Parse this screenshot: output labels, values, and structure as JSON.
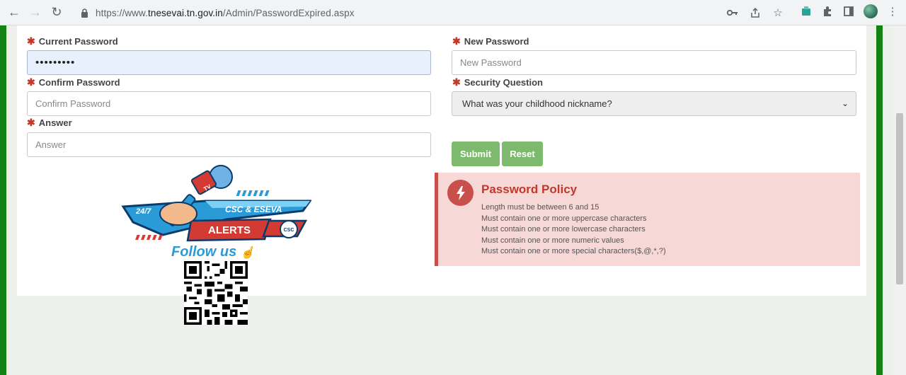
{
  "browser": {
    "url_prefix": "https://www.",
    "url_host": "tnesevai.tn.gov.in",
    "url_path": "/Admin/PasswordExpired.aspx"
  },
  "form": {
    "current_password": {
      "label": "Current Password",
      "value": "•••••••••"
    },
    "new_password": {
      "label": "New Password",
      "placeholder": "New Password"
    },
    "confirm_password": {
      "label": "Confirm Password",
      "placeholder": "Confirm Password"
    },
    "security_question": {
      "label": "Security Question",
      "selected": "What was your childhood nickname?"
    },
    "answer": {
      "label": "Answer",
      "placeholder": "Answer"
    },
    "submit_label": "Submit",
    "reset_label": "Reset"
  },
  "policy": {
    "title": "Password Policy",
    "rules": [
      "Length must be between 6 and 15",
      "Must contain one or more uppercase characters",
      "Must contain one or more lowercase characters",
      "Must contain one or more numeric values",
      "Must contain one or more special characters($,@,*,?)"
    ]
  },
  "promo": {
    "badge_247": "24/7",
    "banner": "CSC & ESEVA",
    "alerts": "ALERTS",
    "csc": "CSC",
    "tv": "TV",
    "follow": "Follow us"
  },
  "colors": {
    "green_border": "#128312",
    "button": "#7dba6e",
    "policy_bg": "#f6d9d6",
    "policy_accent": "#c9504a"
  }
}
